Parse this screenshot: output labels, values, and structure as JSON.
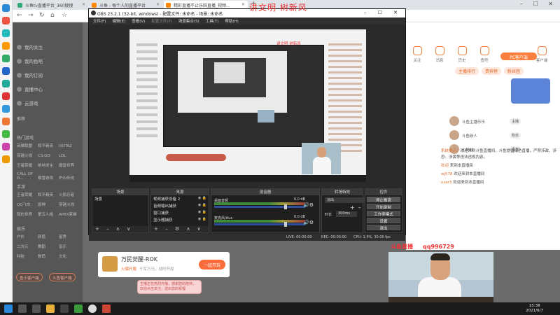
{
  "browser": {
    "tabs": [
      {
        "label": "斗鱼tv直播平台_360搜搜",
        "active": false
      },
      {
        "label": "斗鱼 - 每个人的直播平台",
        "active": false
      },
      {
        "label": "精彩直播不止乐陪直播_视频...",
        "active": true
      }
    ],
    "new_tab": "+",
    "window_controls": "– ☐ ✕",
    "nav": {
      "back": "←",
      "forward": "→",
      "reload": "↻",
      "home": "⌂",
      "star": "☆"
    }
  },
  "watermark": "讲文明 树新风",
  "site_sidebar": {
    "items": [
      "我的关注",
      "我的鱼吧",
      "我的订阅",
      "直播中心",
      "云游戏"
    ],
    "section_recommend": "推荐",
    "section_hot": "热门游戏",
    "hot_games": [
      "英雄联盟",
      "和平精英",
      "DOTA2",
      "穿越火线",
      "CS:GO",
      "LOL",
      "王者荣耀",
      "绝地求生",
      "魔兽世界",
      "CALL OF D...",
      "暴雪游戏",
      "炉石传说"
    ],
    "section_mobile": "手游",
    "mobile_games": [
      "王者荣耀",
      "和平精英",
      "火影忍者",
      "QQ飞车",
      "原神",
      "穿越火线",
      "我的世界",
      "第五人格",
      "APEX英雄"
    ],
    "section_other": "娱乐",
    "other_games": [
      "户外",
      "颜值",
      "星秀",
      "二次元",
      "舞蹈",
      "音乐",
      "科技",
      "数码",
      "文化"
    ],
    "btn_left": "鱼小客户端",
    "btn_right": "斗鱼客户端"
  },
  "obs": {
    "title": "OBS 23.2.1 (32-bit, windows) - 配置文件: 未命名 - 场景: 未命名",
    "menu": [
      "文件(F)",
      "编辑(E)",
      "查看(V)",
      "配置文件(P)",
      "场景集合(S)",
      "工具(T)",
      "帮助(H)"
    ],
    "docks": {
      "scenes": {
        "title": "场景",
        "items": [
          "场景"
        ]
      },
      "sources": {
        "title": "来源",
        "items": [
          "视频捕获设备 2",
          "音频输出捕获",
          "窗口捕获",
          "显示器捕获",
          "视频捕获设备"
        ]
      },
      "mixer": {
        "title": "混音器",
        "channels": [
          {
            "name": "桌面音频",
            "db": "0.0 dB"
          },
          {
            "name": "麦克风/Aux",
            "db": "0.0 dB"
          }
        ]
      },
      "transitions": {
        "title": "转场特效",
        "select": "淡出",
        "duration_label": "时长",
        "duration": "300ms"
      },
      "controls": {
        "title": "控件",
        "buttons": [
          "停止推流",
          "开始录制",
          "工作室模式",
          "设置",
          "退出"
        ]
      }
    },
    "status": {
      "live": "LIVE: 00:00:00",
      "rec": "REC: 00:00:00",
      "cpu": "CPU: 1.4%, 30.00 fps"
    },
    "preview_watermark": "讲文明 树新风"
  },
  "right_site": {
    "top_icons": [
      "关注",
      "消息",
      "历史",
      "鱼吧",
      "客户端"
    ],
    "pc_client": "PC客户端",
    "gift_tabs": [
      "主播排行",
      "贵宾榜",
      "粉丝团"
    ],
    "viewers": [
      {
        "name": "斗鱼主播乐乐",
        "badge": "主播"
      },
      {
        "name": "斗鱼新人",
        "badge": "粉丝"
      },
      {
        "name": "小粉丝",
        "badge": "贵宾"
      }
    ],
    "chat": [
      {
        "user": "系统提示：",
        "text": "欢迎来到斗鱼直播间，斗鱼提倡绿色直播，严禁涉政、涉恐、涉黄等违法违规内容。"
      },
      {
        "user": "欢迎",
        "text": "来到本直播间"
      },
      {
        "user": "wj578",
        "text": "欢迎来到本直播间"
      },
      {
        "user": "user3",
        "text": "欢迎来到本直播间"
      }
    ]
  },
  "game_card": {
    "title": "万民觉醒-ROK",
    "subtitle_hot": "火爆开服",
    "subtitle": "千军万马，战时开局",
    "button": "一起开玩"
  },
  "pink_bubble": "主播正在热烈开播，感谢您的陪伴，欢迎点击关注，送出您的祝福",
  "cam_label": {
    "text": "斗鱼直播",
    "id": "qq996729"
  },
  "clock": {
    "time": "15:38",
    "date": "2021/6/7"
  }
}
